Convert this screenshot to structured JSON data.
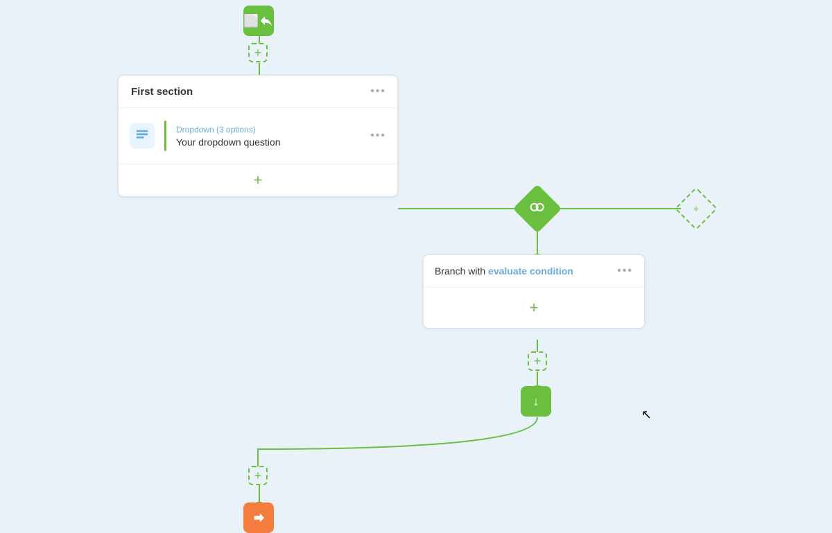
{
  "canvas": {
    "bg_color": "#e8f2f8"
  },
  "start_node": {
    "icon": "➜",
    "aria": "Start node"
  },
  "add_buttons": {
    "label": "+"
  },
  "section_card": {
    "title": "First section",
    "dots": "•••",
    "question": {
      "type": "Dropdown (3 options)",
      "label": "Your dropdown question",
      "icon": "📋"
    },
    "add_question_label": "+"
  },
  "branch_diamond": {
    "icon": "⊗",
    "aria": "Branch condition diamond"
  },
  "branch_diamond_dashed": {
    "icon": "+",
    "aria": "Add branch"
  },
  "branch_card": {
    "title_prefix": "Branch with ",
    "title_highlight": "evaluate condition",
    "dots": "•••",
    "add_label": "+"
  },
  "arrow_down_node": {
    "icon": "↓"
  },
  "end_node": {
    "icon": "➜",
    "aria": "End node"
  }
}
